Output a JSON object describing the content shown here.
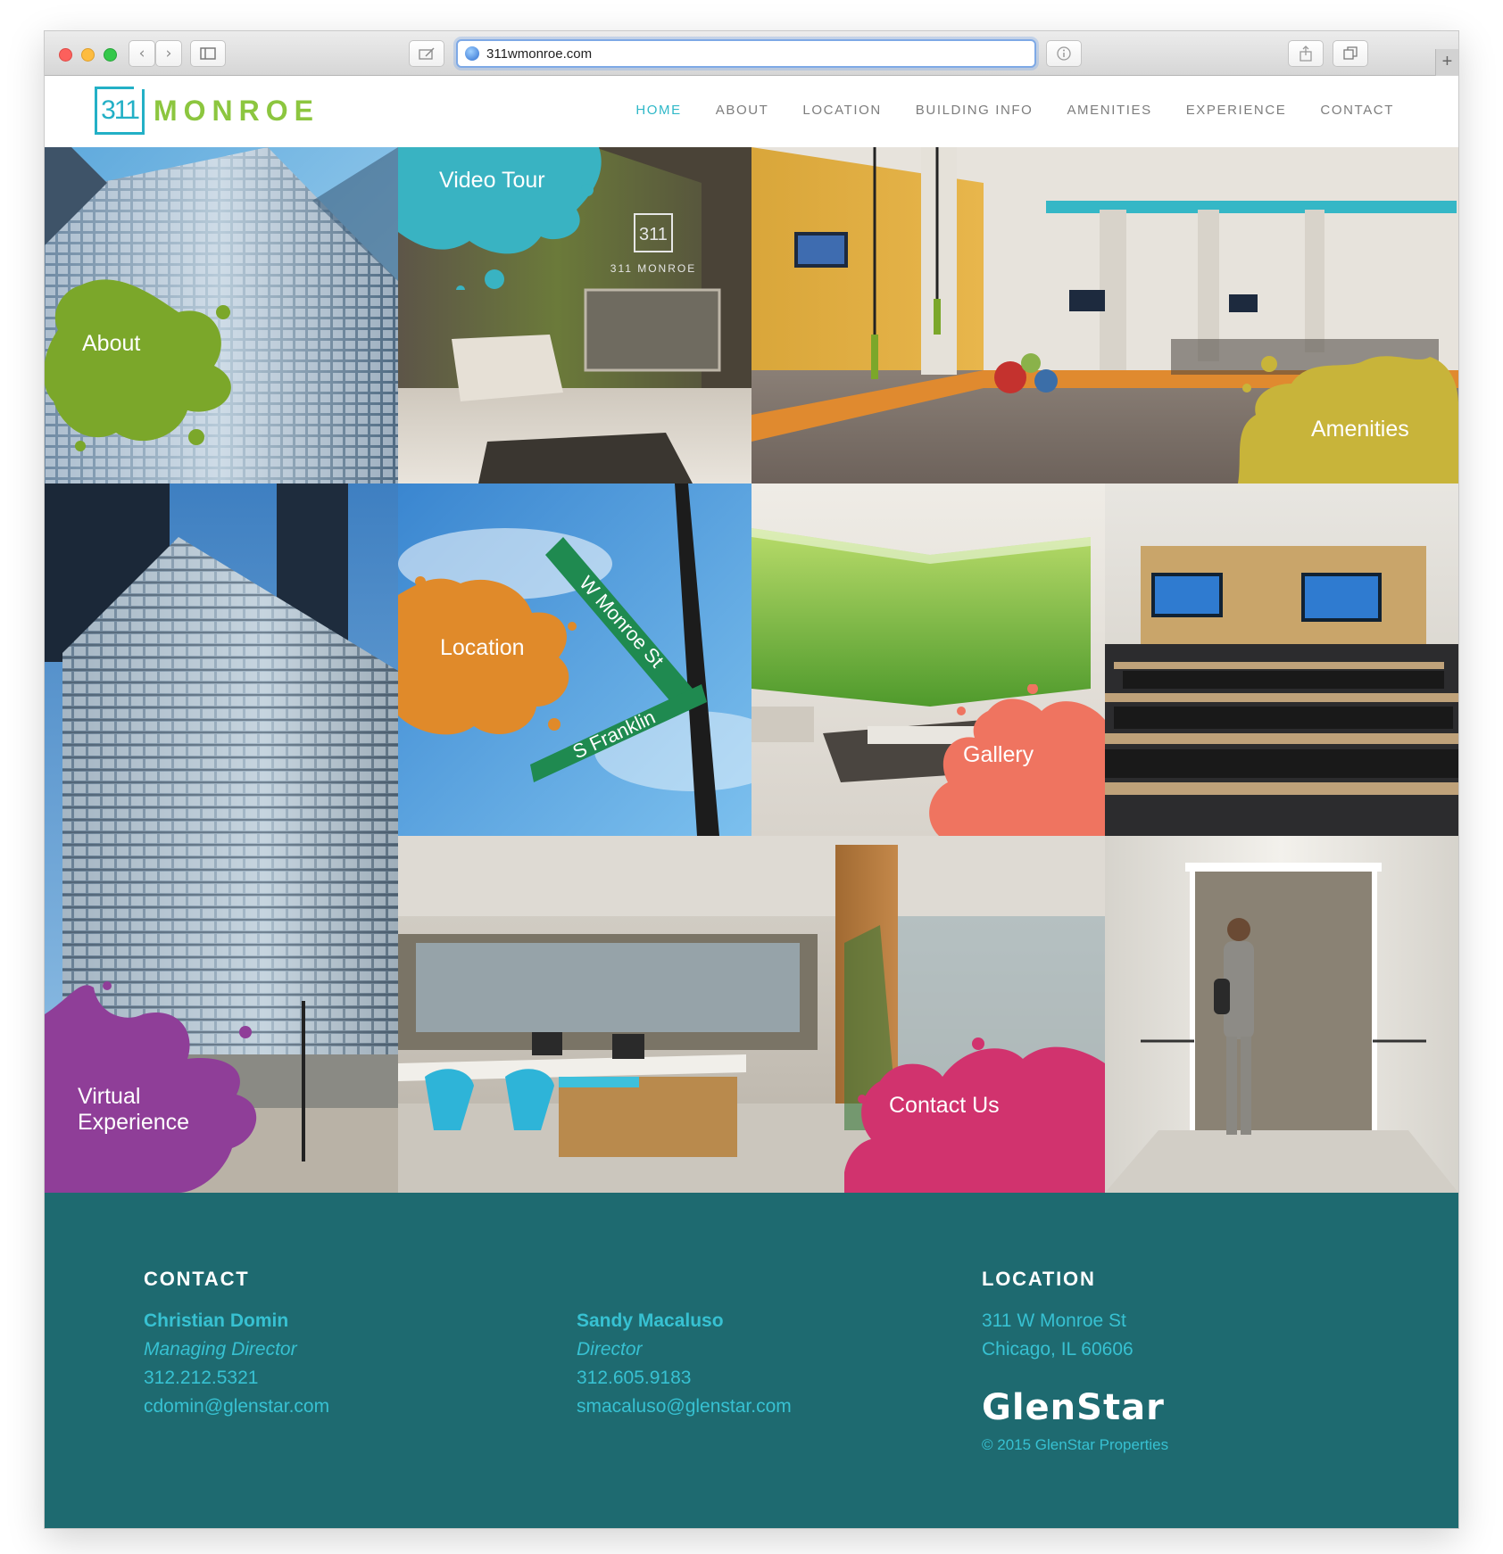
{
  "browser": {
    "url": "311wmonroe.com",
    "back_icon": "chevron-left-icon",
    "forward_icon": "chevron-right-icon"
  },
  "site": {
    "logo_number": "311",
    "logo_word": "MONROE",
    "nav": [
      {
        "label": "HOME",
        "active": true
      },
      {
        "label": "ABOUT",
        "active": false
      },
      {
        "label": "LOCATION",
        "active": false
      },
      {
        "label": "BUILDING INFO",
        "active": false
      },
      {
        "label": "AMENITIES",
        "active": false
      },
      {
        "label": "EXPERIENCE",
        "active": false
      },
      {
        "label": "CONTACT",
        "active": false
      }
    ]
  },
  "tiles": {
    "about": "About",
    "video_tour": "Video Tour",
    "amenities": "Amenities",
    "location": "Location",
    "gallery": "Gallery",
    "virtual_line1": "Virtual",
    "virtual_line2": "Experience",
    "contact_us": "Contact Us",
    "lobby_sign_number": "311",
    "lobby_sign_word": "311 MONROE",
    "street_sign_1": "W Monroe St",
    "street_sign_2": "S Franklin",
    "colors": {
      "about": "#7ba72a",
      "video_tour": "#39b3c2",
      "amenities": "#c8b43a",
      "location": "#e08a2a",
      "gallery": "#ef7460",
      "virtual": "#8f3e98",
      "contact_us": "#d1336e"
    }
  },
  "footer": {
    "contact_heading": "CONTACT",
    "location_heading": "LOCATION",
    "person1": {
      "name": "Christian Domin",
      "title": "Managing Director",
      "phone": "312.212.5321",
      "email": "cdomin@glenstar.com"
    },
    "person2": {
      "name": "Sandy Macaluso",
      "title": "Director",
      "phone": "312.605.9183",
      "email": "smacaluso@glenstar.com"
    },
    "address_line1": "311 W Monroe St",
    "address_line2": "Chicago, IL 60606",
    "brand": "GlenStar",
    "copyright": "© 2015 GlenStar Properties",
    "bg_color": "#1e6a70",
    "accent_color": "#37c1d2"
  }
}
